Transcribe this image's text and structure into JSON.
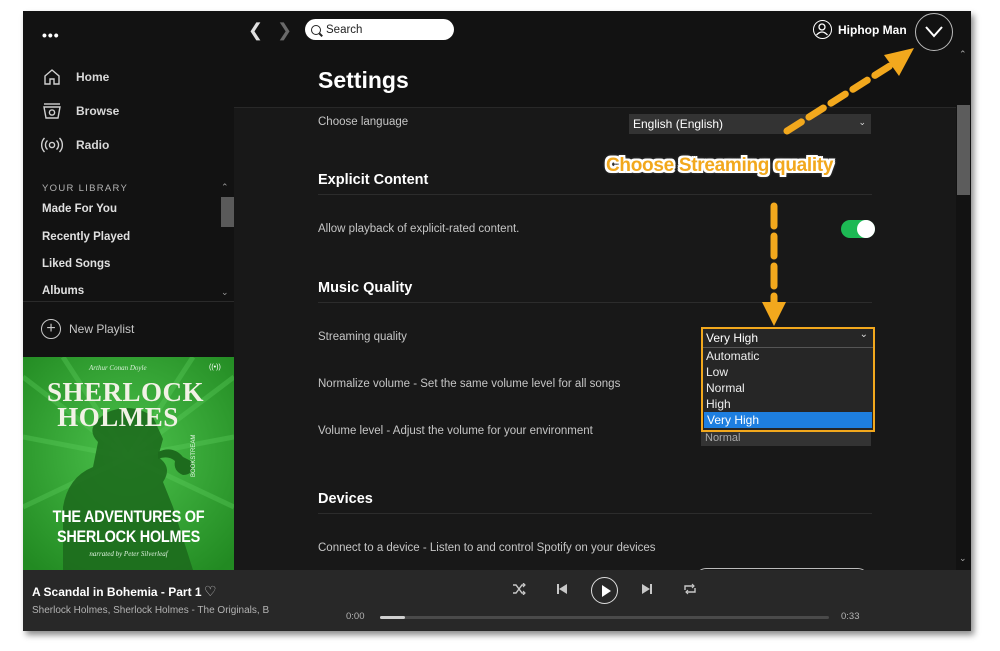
{
  "sidebar": {
    "menu_label": "•••",
    "nav": [
      {
        "label": "Home",
        "icon": "home-icon"
      },
      {
        "label": "Browse",
        "icon": "browse-icon"
      },
      {
        "label": "Radio",
        "icon": "radio-icon"
      }
    ],
    "library_heading": "YOUR LIBRARY",
    "library_items": [
      "Made For You",
      "Recently Played",
      "Liked Songs",
      "Albums"
    ],
    "new_playlist_label": "New Playlist",
    "cover": {
      "author": "Arthur Conan Doyle",
      "title_line1": "SHERLOCK",
      "title_line2": "HOLMES",
      "subtitle_line1": "THE ADVENTURES OF",
      "subtitle_line2": "SHERLOCK HOLMES",
      "narrator": "narrated by Peter Silverleaf",
      "publisher": "BOOKSTREAM",
      "colors": {
        "background": "#2d9a2d",
        "silhouette": "#1d6b1d"
      }
    }
  },
  "topbar": {
    "search_placeholder": "Search",
    "user_name": "Hiphop Man"
  },
  "settings": {
    "title": "Settings",
    "language_label": "Choose language",
    "language_value": "English (English)",
    "explicit_heading": "Explicit Content",
    "explicit_label": "Allow playback of explicit-rated content.",
    "explicit_enabled": true,
    "music_quality_heading": "Music Quality",
    "streaming_label": "Streaming quality",
    "streaming_value": "Very High",
    "streaming_options": [
      "Automatic",
      "Low",
      "Normal",
      "High",
      "Very High"
    ],
    "streaming_selected_index": 4,
    "normalize_label": "Normalize volume - Set the same volume level for all songs",
    "volume_level_label": "Volume level - Adjust the volume for your environment",
    "volume_level_value": "Normal",
    "devices_heading": "Devices",
    "devices_label": "Connect to a device - Listen to and control Spotify on your devices"
  },
  "player": {
    "track_title": "A Scandal in Bohemia - Part 1",
    "artists": "Sherlock Holmes, Sherlock Holmes - The Originals, B",
    "elapsed": "0:00",
    "duration": "0:33",
    "progress_fraction": 0.02
  },
  "annotation": {
    "text": "Choose Streaming quality",
    "color": "#f2a81d"
  },
  "colors": {
    "accent_green": "#1db954",
    "selection_blue": "#1e7fe0",
    "highlight_orange": "#f2a81d"
  }
}
